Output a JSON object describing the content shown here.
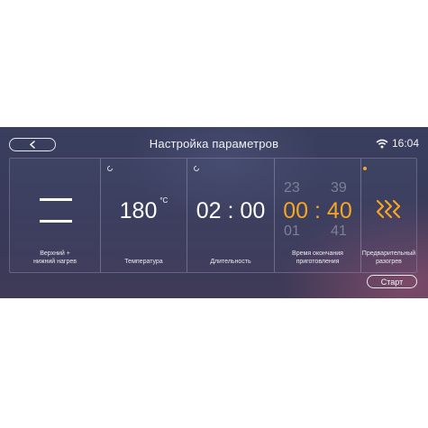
{
  "header": {
    "title": "Настройка параметров",
    "time": "16:04",
    "back_icon": "chevron-left-icon",
    "wifi_icon": "wifi-icon"
  },
  "tiles": [
    {
      "id": "mode",
      "label_line1": "Верхний +",
      "label_line2": "нижний нагрев",
      "icon": "upper-lower-heating-icon"
    },
    {
      "id": "temperature",
      "label": "Температура",
      "value": "180",
      "unit": "°C"
    },
    {
      "id": "duration",
      "label": "Длительность",
      "hours": "02",
      "minutes": "00"
    },
    {
      "id": "end-time",
      "label_line1": "Время окончания",
      "label_line2": "приготовления",
      "prev_hours": "23",
      "prev_minutes": "39",
      "hours": "00",
      "minutes": "40",
      "next_hours": "01",
      "next_minutes": "41"
    },
    {
      "id": "preheat",
      "label_line1": "Предварительный",
      "label_line2": "разогрев",
      "icon": "preheat-waves-icon"
    }
  ],
  "start_button": "Старт",
  "colors": {
    "accent": "#f5a623",
    "background": "#3a3f5f",
    "text": "#ffffff",
    "muted": "#7c8199"
  }
}
